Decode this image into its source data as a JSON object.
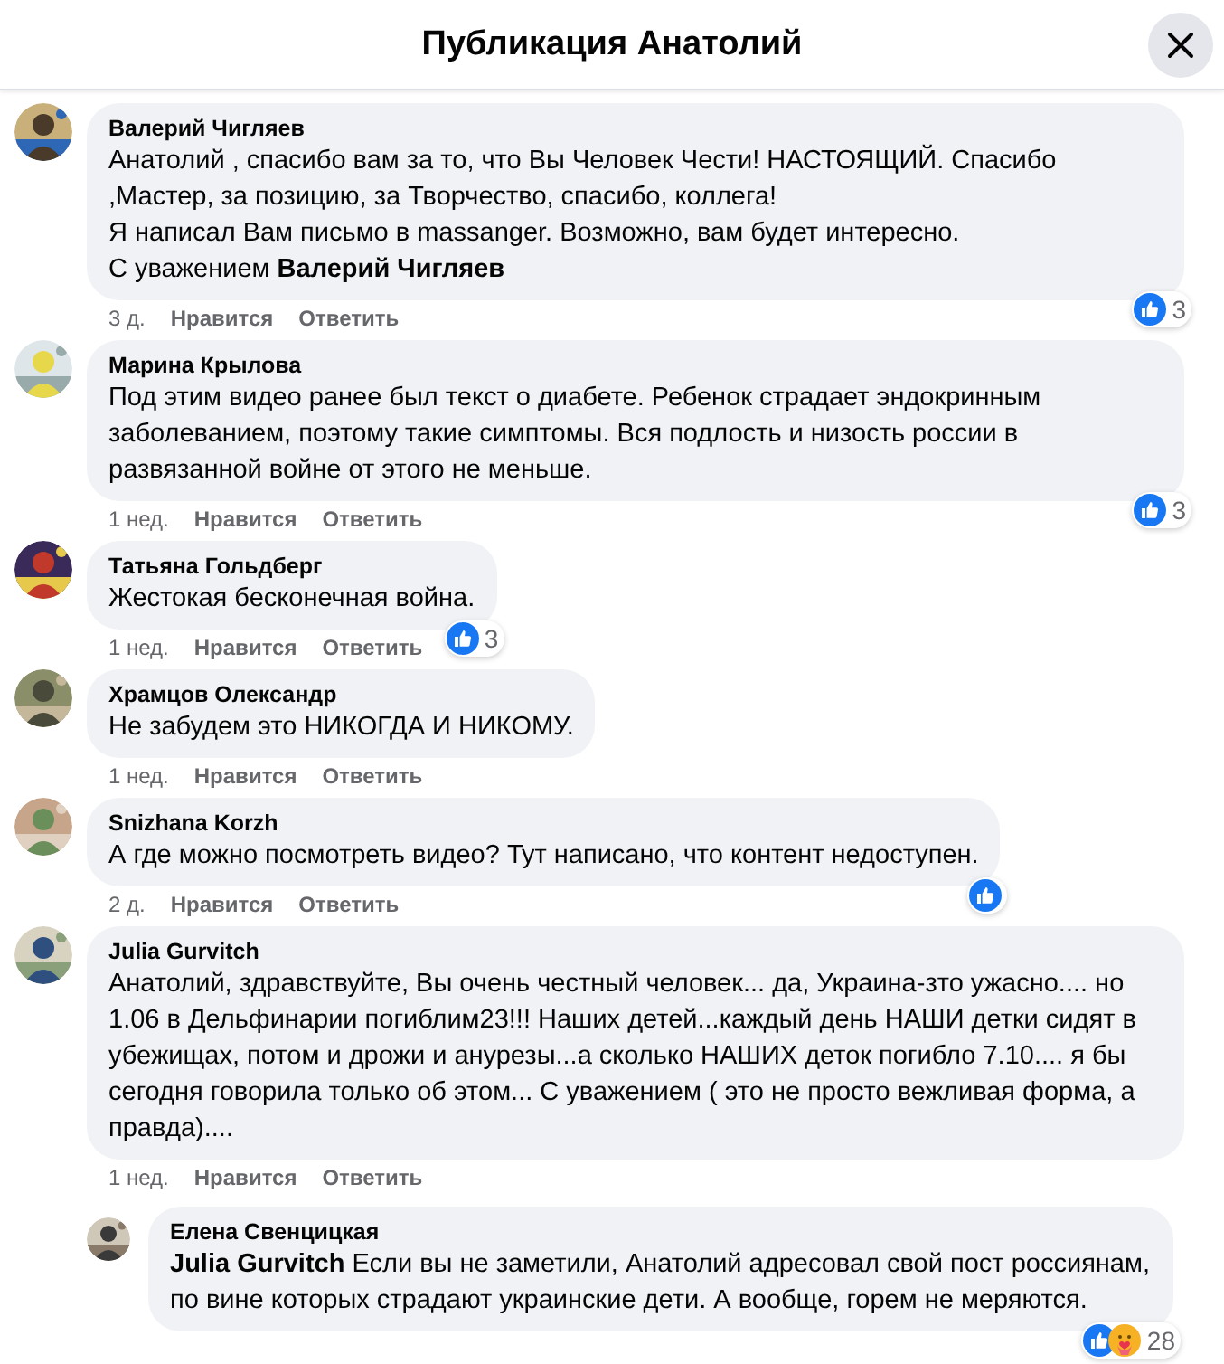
{
  "header": {
    "title": "Публикация Анатолий"
  },
  "comments": [
    {
      "author": "Валерий Чигляев",
      "text": "Анатолий , спасибо вам за то, что Вы Человек Чести! НАСТОЯЩИЙ. Спасибо ,Мастер, за позицию, за Творчество, спасибо, коллега!\nЯ написал Вам письмо в massanger. Возможно, вам будет интересно.\nС уважением **Валерий Чигляев**",
      "time": "3 д.",
      "like": "Нравится",
      "reply": "Ответить",
      "reactions": [
        {
          "kind": "like"
        }
      ],
      "count": "3"
    },
    {
      "author": "Марина Крылова",
      "text": "Под этим видео ранее был текст о диабете. Ребенок страдает эндокринным заболеванием, поэтому такие симптомы. Вся подлость и низость россии в развязанной войне от этого не меньше.",
      "time": "1 нед.",
      "like": "Нравится",
      "reply": "Ответить",
      "reactions": [
        {
          "kind": "like"
        }
      ],
      "count": "3"
    },
    {
      "author": "Татьяна Гольдберг",
      "text": "Жестокая бесконечная война.",
      "time": "1 нед.",
      "like": "Нравится",
      "reply": "Ответить",
      "reactions": [
        {
          "kind": "like"
        }
      ],
      "count": "3"
    },
    {
      "author": "Храмцов Олександр",
      "text": "Не забудем это НИКОГДА И НИКОМУ.",
      "time": "1 нед.",
      "like": "Нравится",
      "reply": "Ответить"
    },
    {
      "author": "Snizhana Korzh",
      "text": "А где можно посмотреть видео? Тут написано, что контент недоступен.",
      "time": "2 д.",
      "like": "Нравится",
      "reply": "Ответить",
      "reactions": [
        {
          "kind": "like"
        }
      ]
    },
    {
      "author": "Julia Gurvitch",
      "text": "Анатолий, здравствуйте, Вы очень честный человек... да, Украина-зто ужасно.... но 1.06 в Дельфинарии погиблим23!!! Наших детей...каждый день НАШИ детки сидят в убежищах, потом и дрожи и анурезы...а сколько НАШИХ деток погибло 7.10.... я бы сегодня говорила только об этом... С уважением ( это не просто вежливая форма, а правда)....",
      "time": "1 нед.",
      "like": "Нравится",
      "reply": "Ответить",
      "children": [
        {
          "author": "Елена Свенцицкая",
          "text": "**Julia Gurvitch** Если вы не заметили, Анатолий адресовал свой пост россиянам, по вине которых страдают украинские дети. А вообще, горем не меряются.",
          "reactions": [
            {
              "kind": "like"
            },
            {
              "kind": "care"
            }
          ],
          "count": "28"
        }
      ]
    }
  ]
}
